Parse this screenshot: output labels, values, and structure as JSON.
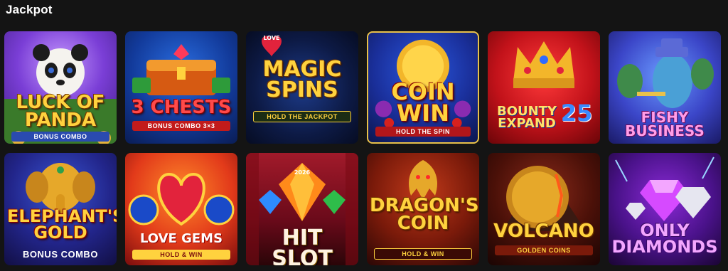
{
  "section": {
    "title": "Jackpot"
  },
  "games": [
    {
      "name": "LUCK OF PANDA",
      "sub": "BONUS COMBO"
    },
    {
      "name": "3 CHESTS",
      "sub": "BONUS COMBO 3×3"
    },
    {
      "name": "MAGIC SPINS",
      "sub": "HOLD THE JACKPOT",
      "badge": "LOVE"
    },
    {
      "name": "COIN WIN",
      "sub": "HOLD THE SPIN"
    },
    {
      "name": "BOUNTY EXPAND",
      "sub": "25"
    },
    {
      "name": "FISHY BUSINESS",
      "sub": ""
    },
    {
      "name": "ELEPHANT'S GOLD",
      "sub": "BONUS COMBO"
    },
    {
      "name": "LOVE GEMS",
      "sub": "HOLD & WIN"
    },
    {
      "name": "HIT SLOT",
      "sub": "2026"
    },
    {
      "name": "DRAGON'S COIN",
      "sub": "HOLD & WIN"
    },
    {
      "name": "VOLCANO",
      "sub": "GOLDEN COINS"
    },
    {
      "name": "ONLY DIAMONDS",
      "sub": ""
    }
  ],
  "colors": {
    "highlight_border": "#e8c14a",
    "background": "#141414"
  }
}
